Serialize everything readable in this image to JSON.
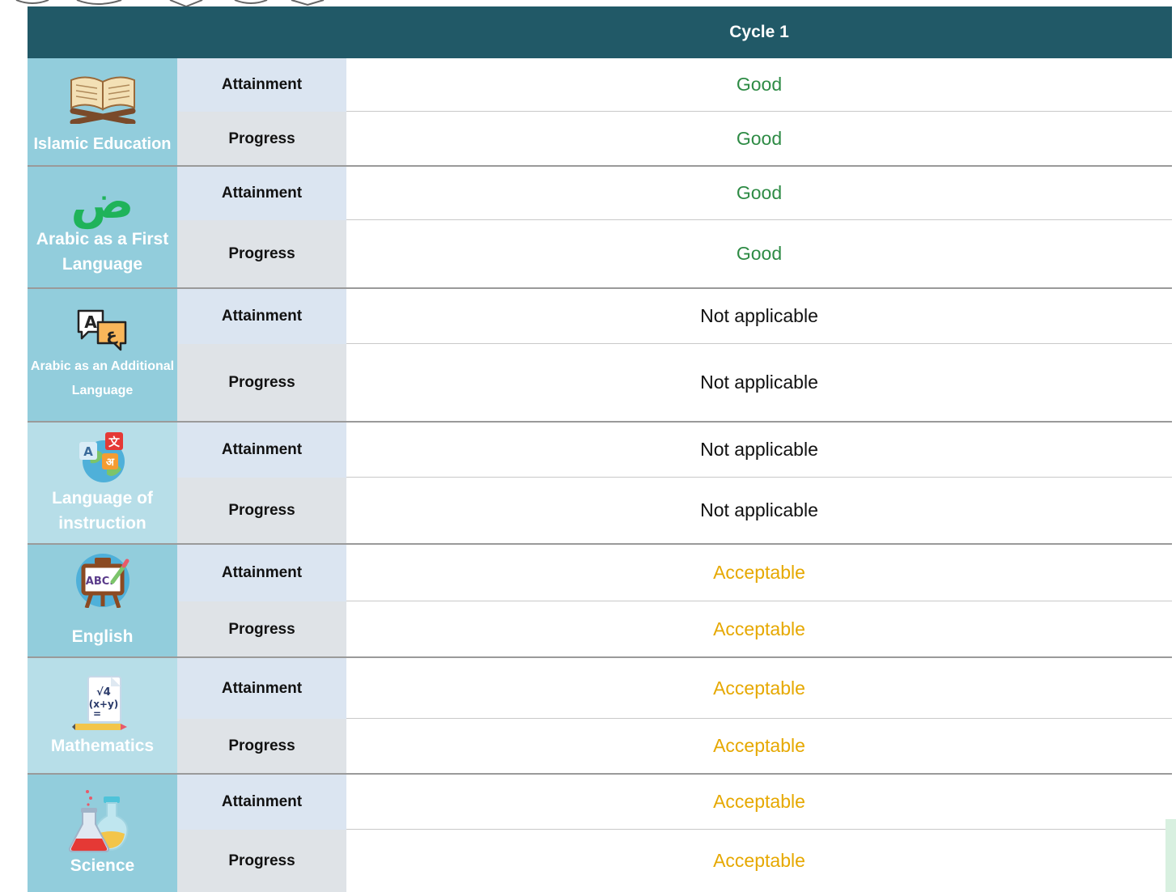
{
  "table": {
    "header": "Cycle 1",
    "colors": {
      "good": "#2e8b45",
      "acceptable": "#e6a800",
      "na": "#111111",
      "header_bg": "#215967"
    },
    "subjects": [
      {
        "name": "Islamic Education",
        "icon": "open-book-icon",
        "attainment": {
          "label": "Attainment",
          "value": "Good"
        },
        "progress": {
          "label": "Progress",
          "value": "Good"
        }
      },
      {
        "name": "Arabic as a First Language",
        "icon": "arabic-letter-icon",
        "attainment": {
          "label": "Attainment",
          "value": "Good"
        },
        "progress": {
          "label": "Progress",
          "value": "Good"
        }
      },
      {
        "name": "Arabic as an Additional Language",
        "icon": "translation-bubbles-icon",
        "attainment": {
          "label": "Attainment",
          "value": "Not applicable"
        },
        "progress": {
          "label": "Progress",
          "value": "Not applicable"
        }
      },
      {
        "name": "Language of instruction",
        "icon": "language-globe-icon",
        "attainment": {
          "label": "Attainment",
          "value": "Not applicable"
        },
        "progress": {
          "label": "Progress",
          "value": "Not applicable"
        }
      },
      {
        "name": "English",
        "icon": "abc-easel-icon",
        "attainment": {
          "label": "Attainment",
          "value": "Acceptable"
        },
        "progress": {
          "label": "Progress",
          "value": "Acceptable"
        }
      },
      {
        "name": "Mathematics",
        "icon": "math-notebook-icon",
        "attainment": {
          "label": "Attainment",
          "value": "Acceptable"
        },
        "progress": {
          "label": "Progress",
          "value": "Acceptable"
        }
      },
      {
        "name": "Science",
        "icon": "flasks-icon",
        "attainment": {
          "label": "Attainment",
          "value": "Acceptable"
        },
        "progress": {
          "label": "Progress",
          "value": "Acceptable"
        }
      }
    ],
    "icon_text": {
      "arabic_letter": "ض",
      "bubble_a": "A",
      "bubble_ain": "ع",
      "globe_a": "A",
      "globe_zh": "文",
      "globe_hi": "अ",
      "easel": "ABC.",
      "math_root": "√4",
      "math_expr": "(x+y)",
      "math_eq": "="
    }
  }
}
